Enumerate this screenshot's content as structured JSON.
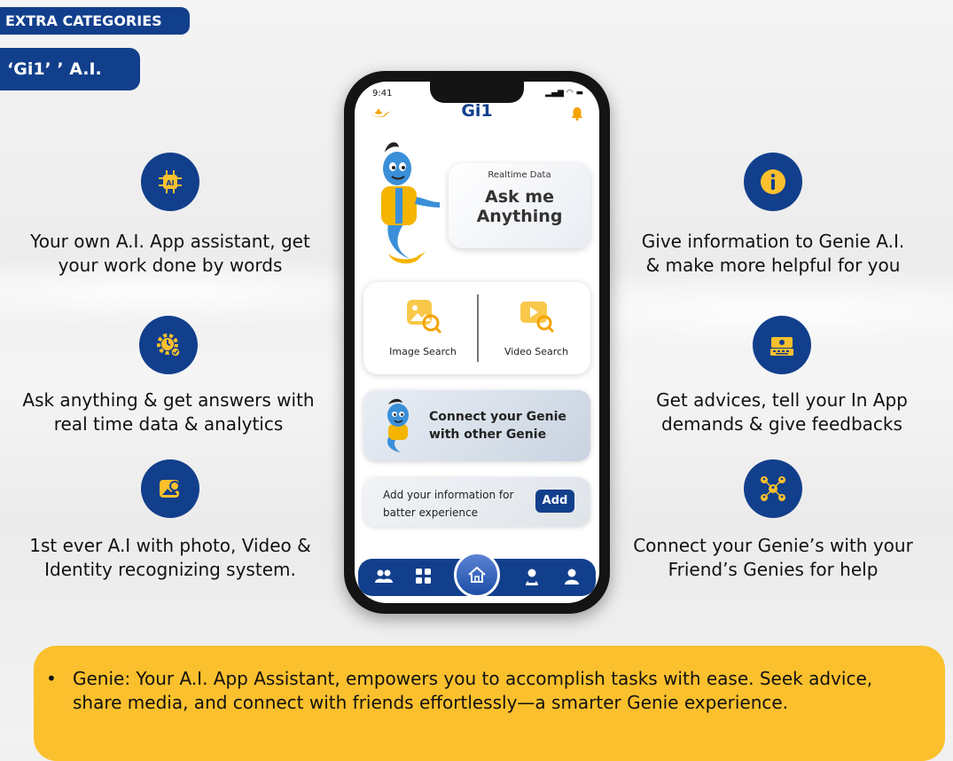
{
  "header": {
    "category": "EXTRA CATEGORIES",
    "title": "‘Gi1’ ’ A.I."
  },
  "features_left": [
    {
      "icon": "ai-chip-icon",
      "text": "Your own A.I. App assistant, get your work done by words"
    },
    {
      "icon": "gear-clock-icon",
      "text": "Ask anything & get answers with real time data & analytics"
    },
    {
      "icon": "image-search-icon",
      "text": "1st ever A.I with photo, Video & Identity recognizing system."
    }
  ],
  "features_right": [
    {
      "icon": "info-icon",
      "text": "Give information to Genie A.I. & make more helpful for you"
    },
    {
      "icon": "feedback-keyboard-icon",
      "text": "Get advices, tell your In App demands & give feedbacks"
    },
    {
      "icon": "network-people-icon",
      "text": "Connect your Genie’s with your Friend’s Genies for help"
    }
  ],
  "phone": {
    "time": "9:41",
    "app_title": "Gi1",
    "ask_small": "Realtime Data",
    "ask_line1": "Ask me",
    "ask_line2": "Anything",
    "image_search": "Image Search",
    "video_search": "Video Search",
    "connect_line1": "Connect your Genie",
    "connect_line2": "with other Genie",
    "add_line1": "Add your information for",
    "add_line2": "batter experience",
    "add_button": "Add"
  },
  "colors": {
    "brand_blue": "#123f8c",
    "accent_yellow": "#fbc02d",
    "genie_blue": "#3a8fd8"
  },
  "note": {
    "text": "Genie: Your A.I. App Assistant, empowers you to accomplish tasks with ease. Seek advice, share media, and connect with friends effortlessly—a smarter Genie experience."
  }
}
